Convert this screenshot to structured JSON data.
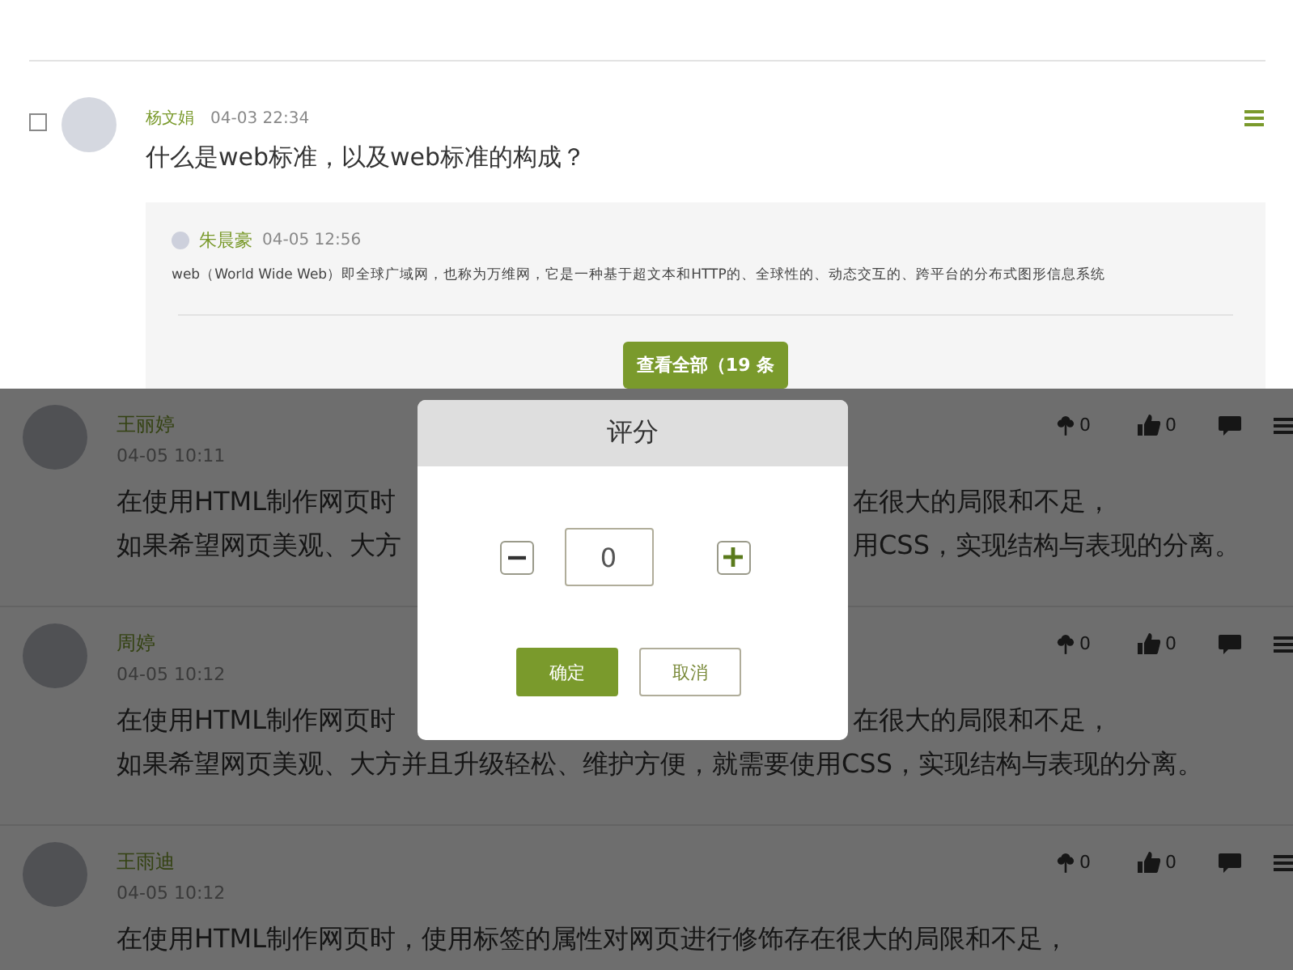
{
  "question": {
    "checked": false,
    "author": "杨文娟",
    "time": "04-03 22:34",
    "text": "什么是web标准，以及web标准的构成？",
    "reply": {
      "author": "朱晨豪",
      "time": "04-05 12:56",
      "text": "web（World Wide Web）即全球广域网，也称为万维网，它是一种基于超文本和HTTP的、全球性的、动态交互的、跨平台的分布式图形信息系统"
    },
    "view_all": "查看全部（19 条"
  },
  "comments": [
    {
      "author": "王丽婷",
      "time": "04-05 10:11",
      "lines": [
        [
          "在使用HTML制作网页时",
          "在很大的局限和不足，"
        ],
        [
          "如果希望网页美观、大方",
          "用CSS，实现结构与表现的分离。"
        ]
      ],
      "flowers": "0",
      "likes": "0"
    },
    {
      "author": "周婷",
      "time": "04-05 10:12",
      "lines": [
        [
          "在使用HTML制作网页时",
          "在很大的局限和不足，"
        ],
        [
          "如果希望网页美观、大方并且升级轻松、维护方便，就需要使用CSS，实现结构与表现的分离。"
        ]
      ],
      "flowers": "0",
      "likes": "0"
    },
    {
      "author": "王雨迪",
      "time": "04-05 10:12",
      "lines": [
        [
          "在使用HTML制作网页时，使用标签的属性对网页进行修饰存在很大的局限和不足，"
        ]
      ],
      "flowers": "0",
      "likes": "0"
    }
  ],
  "dialog": {
    "title": "评分",
    "value": "0",
    "confirm": "确定",
    "cancel": "取消"
  }
}
